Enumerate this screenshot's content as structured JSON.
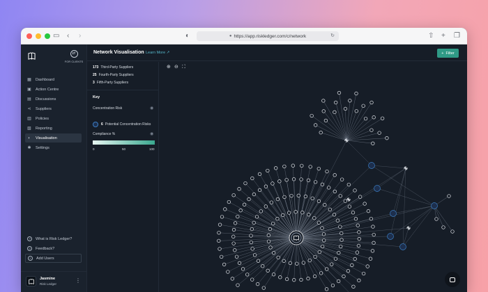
{
  "browser": {
    "url": "https://app.riskledger.com/c/network",
    "colors": {
      "close": "#fe5f57",
      "minimize": "#febc2e",
      "maximize": "#28c840"
    }
  },
  "sidebar": {
    "client_switch_label": "FOR CLIENTS",
    "nav": [
      {
        "label": "Dashboard",
        "icon": "dashboard-icon",
        "active": false
      },
      {
        "label": "Action Centre",
        "icon": "action-centre-icon",
        "active": false
      },
      {
        "label": "Discussions",
        "icon": "discussions-icon",
        "active": false
      },
      {
        "label": "Suppliers",
        "icon": "suppliers-icon",
        "active": false
      },
      {
        "label": "Policies",
        "icon": "policies-icon",
        "active": false
      },
      {
        "label": "Reporting",
        "icon": "reporting-icon",
        "active": false
      },
      {
        "label": "Visualisation",
        "icon": "visualisation-icon",
        "active": true
      },
      {
        "label": "Settings",
        "icon": "settings-icon",
        "active": false
      }
    ],
    "bottom": [
      {
        "label": "What is Risk Ledger?",
        "icon": "help-icon"
      },
      {
        "label": "Feedback?",
        "icon": "feedback-icon"
      },
      {
        "label": "Add Users",
        "icon": "add-users-icon"
      }
    ],
    "profile": {
      "name": "Jasmine",
      "org": "Risk Ledger"
    }
  },
  "header": {
    "title": "Network Visualisation",
    "learn_more": "Learn More",
    "filter": "Filter"
  },
  "panel": {
    "stats": [
      {
        "count": "173",
        "label": "Third-Party Suppliers"
      },
      {
        "count": "25",
        "label": "Fourth-Party Suppliers"
      },
      {
        "count": "3",
        "label": "Fifth-Party Suppliers"
      }
    ],
    "key_title": "Key",
    "concentration_title": "Concentration Risk",
    "concentration_count": "6",
    "concentration_label": "Potential Concentration Risks",
    "compliance_title": "Compliance %",
    "ticks": [
      "0",
      "50",
      "100"
    ]
  },
  "graph": {
    "accent": "#3c7ec4",
    "node_stroke": "#e6e9ee",
    "edge": "#8a94a3"
  }
}
